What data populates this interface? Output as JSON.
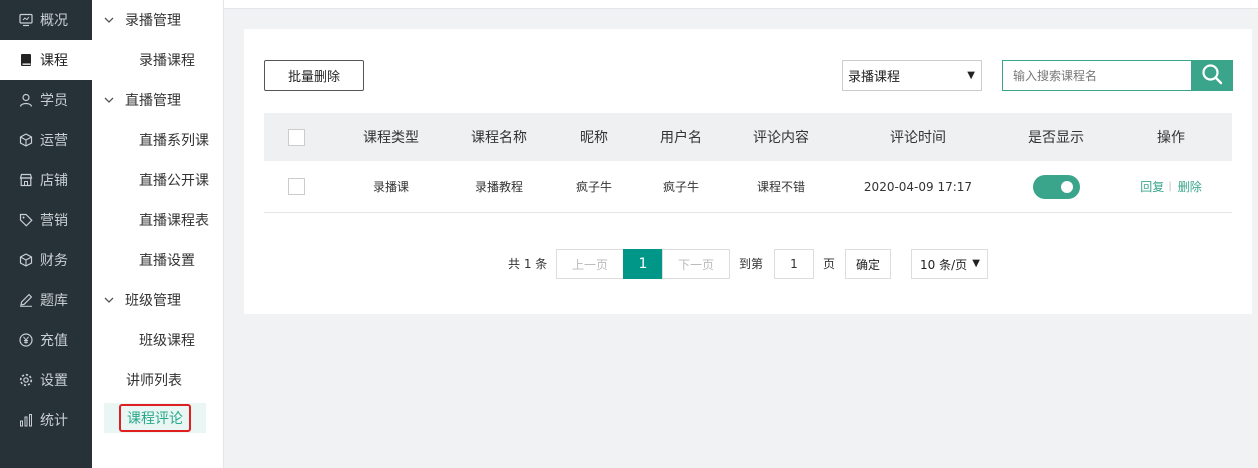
{
  "nav": [
    {
      "name": "overview",
      "label": "概况",
      "icon": "monitor-icon",
      "active": false
    },
    {
      "name": "course",
      "label": "课程",
      "icon": "book-icon",
      "active": true
    },
    {
      "name": "student",
      "label": "学员",
      "icon": "user-icon",
      "active": false
    },
    {
      "name": "operation",
      "label": "运营",
      "icon": "cube-icon",
      "active": false
    },
    {
      "name": "shop",
      "label": "店铺",
      "icon": "store-icon",
      "active": false
    },
    {
      "name": "marketing",
      "label": "营销",
      "icon": "tag-icon",
      "active": false
    },
    {
      "name": "finance",
      "label": "财务",
      "icon": "cube-icon",
      "active": false
    },
    {
      "name": "question-bank",
      "label": "题库",
      "icon": "pencil-icon",
      "active": false
    },
    {
      "name": "recharge",
      "label": "充值",
      "icon": "yen-icon",
      "active": false
    },
    {
      "name": "settings",
      "label": "设置",
      "icon": "gear-icon",
      "active": false
    },
    {
      "name": "statistics",
      "label": "统计",
      "icon": "bar-chart-icon",
      "active": false
    }
  ],
  "submenu": {
    "recorded_group": "录播管理",
    "recorded_course": "录播课程",
    "live_group": "直播管理",
    "live_series": "直播系列课",
    "live_open": "直播公开课",
    "live_schedule": "直播课程表",
    "live_settings": "直播设置",
    "class_group": "班级管理",
    "class_course": "班级课程",
    "teacher_list": "讲师列表",
    "course_review": "课程评论"
  },
  "toolbar": {
    "batch_delete": "批量删除",
    "course_type_selected": "录播课程",
    "search_placeholder": "输入搜索课程名"
  },
  "table": {
    "headers": [
      "课程类型",
      "课程名称",
      "昵称",
      "用户名",
      "评论内容",
      "评论时间",
      "是否显示",
      "操作"
    ],
    "rows": [
      {
        "course_type": "录播课",
        "course_name": "录播教程",
        "nickname": "疯子牛",
        "username": "疯子牛",
        "content": "课程不错",
        "time": "2020-04-09 17:17",
        "show": true,
        "reply": "回复",
        "delete": "删除"
      }
    ]
  },
  "pagination": {
    "total": "共 1 条",
    "prev": "上一页",
    "current": "1",
    "next": "下一页",
    "goto_label": "到第",
    "goto_value": "1",
    "page_unit": "页",
    "confirm": "确定",
    "page_size": "10 条/页"
  },
  "colors": {
    "sidebar_bg": "#263238",
    "accent": "#3aa58b",
    "page_active": "#009688",
    "highlight_border": "#e02020"
  }
}
